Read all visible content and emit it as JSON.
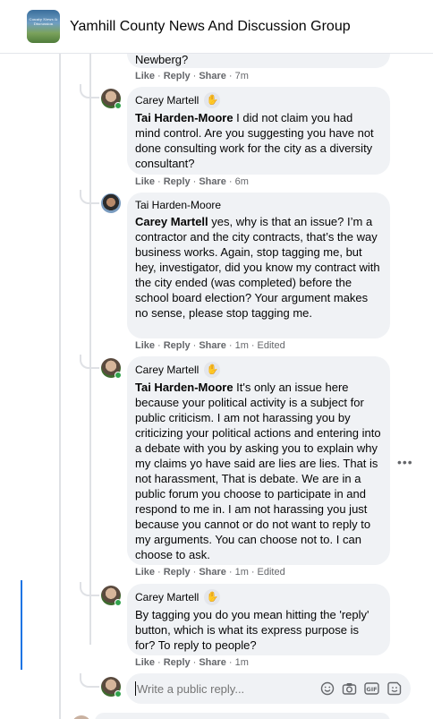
{
  "group": {
    "title": "Yamhill County News And Discussion Group",
    "logo_text": "County News & Discussion"
  },
  "actions": {
    "like": "Like",
    "reply": "Reply",
    "share": "Share",
    "dot": "·"
  },
  "top_comment": {
    "text_tail": "Newberg?",
    "time": "7m"
  },
  "comments": [
    {
      "author": "Carey Martell",
      "mention": "Tai Harden-Moore",
      "text": " I did not claim you had mind control. Are you suggesting you have not done consulting work for the city as a diversity consultant?",
      "time": "6m",
      "edited": ""
    },
    {
      "author": "Tai Harden-Moore",
      "mention": "Carey Martell",
      "text": " yes, why is that an issue? I’m a contractor and the city contracts, that’s the way business works. Again, stop tagging me, but hey, investigator, did you know my contract with the city ended (was completed) before the school board election? Your argument makes no sense, please stop tagging me.",
      "time": "1m",
      "edited": "Edited"
    },
    {
      "author": "Carey Martell",
      "mention": "Tai Harden-Moore",
      "text": " It's only an issue here because your political activity is a subject for public criticism. I am not harassing you by criticizing your political actions and entering into a debate with you by asking you to explain why my claims yo have said are lies are lies. That is not harassment, That is debate. We are in a public forum you choose to participate in and respond to me in. I am not harassing you just because you cannot or do not want to reply to my arguments. You can choose not to. I can choose to ask.",
      "time": "1m",
      "edited": "Edited"
    },
    {
      "author": "Carey Martell",
      "mention": "",
      "text": "By tagging you do you mean hitting the 'reply' button, which is what its express purpose is for? To reply to people?",
      "time": "1m",
      "edited": ""
    }
  ],
  "reply_box": {
    "placeholder": "Write a public reply..."
  },
  "icons": {
    "badge": "top-fan-badge-icon",
    "emoji": "emoji-icon",
    "camera": "camera-icon",
    "gif": "gif-icon",
    "sticker": "sticker-icon",
    "more": "more-options-icon"
  },
  "colors": {
    "bubble": "#f0f2f5",
    "online": "#31a24c",
    "accent": "#1b74e4"
  }
}
